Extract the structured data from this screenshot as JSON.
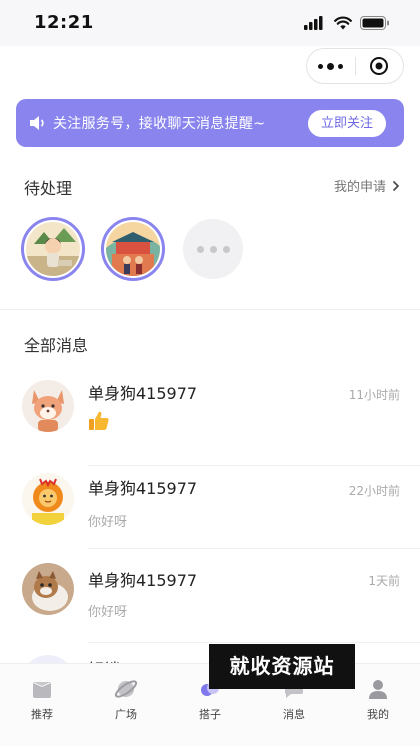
{
  "status_bar": {
    "time": "12:21"
  },
  "banner": {
    "text": "关注服务号，接收聊天消息提醒~",
    "button_label": "立即关注"
  },
  "pending": {
    "title": "待处理",
    "my_apply_label": "我的申请"
  },
  "messages": {
    "title": "全部消息",
    "items": [
      {
        "name": "单身狗415977",
        "time": "11小时前",
        "preview": "thumbs-up-emoji"
      },
      {
        "name": "单身狗415977",
        "time": "22小时前",
        "preview": "你好呀"
      },
      {
        "name": "单身狗415977",
        "time": "1天前",
        "preview": "你好呀"
      },
      {
        "name": "解锁"
      }
    ]
  },
  "nav": {
    "items": [
      {
        "label": "推荐",
        "icon": "recommend-icon"
      },
      {
        "label": "广场",
        "icon": "planet-icon"
      },
      {
        "label": "搭子",
        "icon": "partner-icon"
      },
      {
        "label": "消息",
        "icon": "message-icon"
      },
      {
        "label": "我的",
        "icon": "profile-icon"
      }
    ]
  },
  "watermark": {
    "text": "就收资源站"
  },
  "colors": {
    "accent": "#8a85ee",
    "accent_dark": "#6f69e6"
  }
}
